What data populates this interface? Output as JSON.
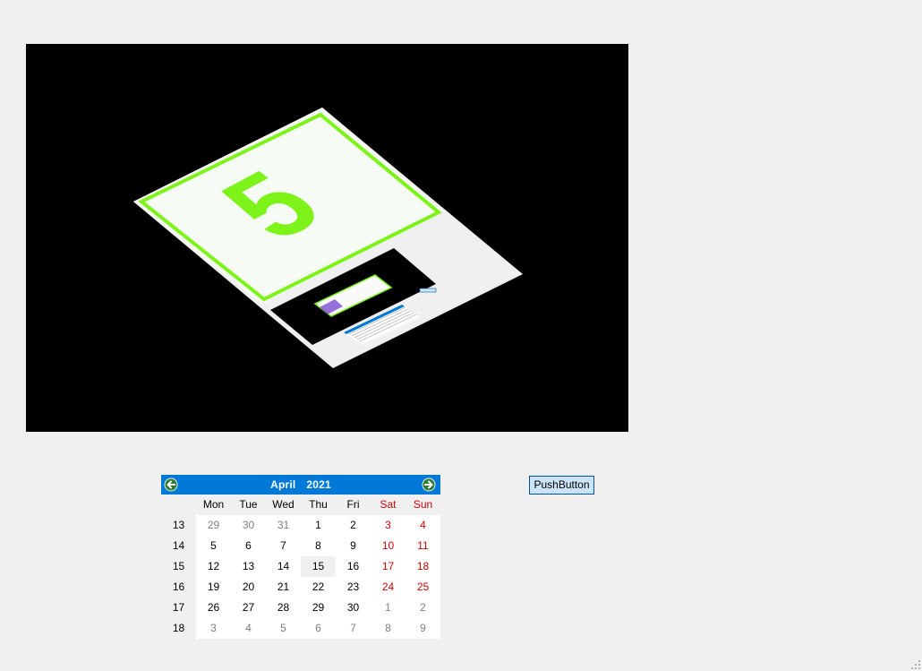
{
  "viewport": {
    "background": "#000000",
    "panel_number": "5",
    "panel_accent": "#7ef31a",
    "panel_face": "#f5faf5"
  },
  "calendar": {
    "month": "April",
    "year": "2021",
    "header_color": "#0078d7",
    "weekend_color": "#d00000",
    "day_headers": [
      "Mon",
      "Tue",
      "Wed",
      "Thu",
      "Fri",
      "Sat",
      "Sun"
    ],
    "weeks": [
      {
        "week": "13",
        "days": [
          "29",
          "30",
          "31",
          "1",
          "2",
          "3",
          "4"
        ]
      },
      {
        "week": "14",
        "days": [
          "5",
          "6",
          "7",
          "8",
          "9",
          "10",
          "11"
        ]
      },
      {
        "week": "15",
        "days": [
          "12",
          "13",
          "14",
          "15",
          "16",
          "17",
          "18"
        ]
      },
      {
        "week": "16",
        "days": [
          "19",
          "20",
          "21",
          "22",
          "23",
          "24",
          "25"
        ]
      },
      {
        "week": "17",
        "days": [
          "26",
          "27",
          "28",
          "29",
          "30",
          "1",
          "2"
        ]
      },
      {
        "week": "18",
        "days": [
          "3",
          "4",
          "5",
          "6",
          "7",
          "8",
          "9"
        ]
      }
    ],
    "today": "15"
  },
  "push_button": {
    "label": "PushButton"
  }
}
